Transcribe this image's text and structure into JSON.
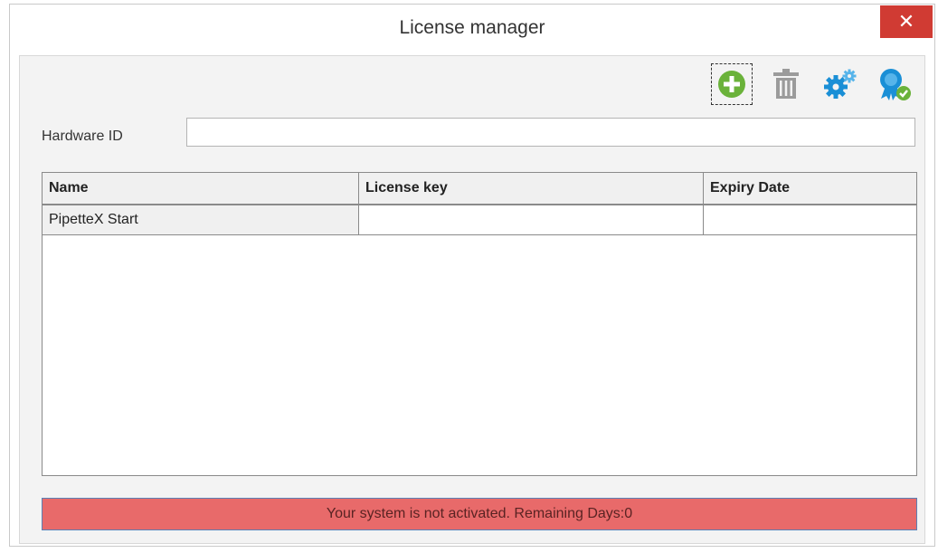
{
  "window": {
    "title": "License manager",
    "close_glyph": "✕"
  },
  "toolbar": {
    "buttons": [
      {
        "name": "add-license-button",
        "icon": "plus-circle-icon",
        "color": "#6ab23a"
      },
      {
        "name": "delete-license-button",
        "icon": "trash-icon",
        "color": "#9b9b9b"
      },
      {
        "name": "settings-button",
        "icon": "gear-icon",
        "color": "#1a8fd6"
      },
      {
        "name": "activate-button",
        "icon": "certificate-check-icon",
        "color": "#1a8fd6"
      }
    ]
  },
  "hardware": {
    "label": "Hardware ID",
    "value": ""
  },
  "grid": {
    "columns": [
      "Name",
      "License key",
      "Expiry Date"
    ],
    "rows": [
      {
        "name": "PipetteX Start",
        "license_key": "",
        "expiry_date": ""
      }
    ]
  },
  "status": {
    "message": "Your system is not activated. Remaining Days:0",
    "color": "#e86a6a"
  }
}
